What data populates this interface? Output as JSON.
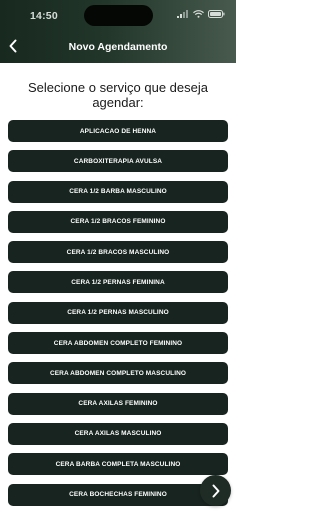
{
  "status_bar": {
    "time": "14:50",
    "icons": [
      "signal-icon",
      "wifi-icon",
      "battery-icon"
    ]
  },
  "nav": {
    "back_icon": "chevron-left-icon",
    "title": "Novo Agendamento"
  },
  "prompt": "Selecione o serviço que deseja agendar:",
  "services": [
    {
      "label": "APLICACAO DE HENNA"
    },
    {
      "label": "CARBOXITERAPIA AVULSA"
    },
    {
      "label": "CERA 1/2 BARBA MASCULINO"
    },
    {
      "label": "CERA 1/2 BRACOS FEMININO"
    },
    {
      "label": "CERA 1/2 BRACOS MASCULINO"
    },
    {
      "label": "CERA 1/2 PERNAS FEMININA"
    },
    {
      "label": "CERA 1/2 PERNAS MASCULINO"
    },
    {
      "label": "CERA ABDOMEN COMPLETO FEMININO"
    },
    {
      "label": "CERA ABDOMEN COMPLETO MASCULINO"
    },
    {
      "label": "CERA AXILAS FEMININO"
    },
    {
      "label": "CERA AXILAS MASCULINO"
    },
    {
      "label": "CERA BARBA COMPLETA MASCULINO"
    },
    {
      "label": "CERA BOCHECHAS FEMININO"
    }
  ],
  "fab": {
    "icon": "chevron-right-icon"
  },
  "colors": {
    "header_dark": "#18291f",
    "header_light": "#485a4e",
    "button_bg": "#182420",
    "button_text": "#ffffff",
    "page_bg": "#ffffff"
  }
}
